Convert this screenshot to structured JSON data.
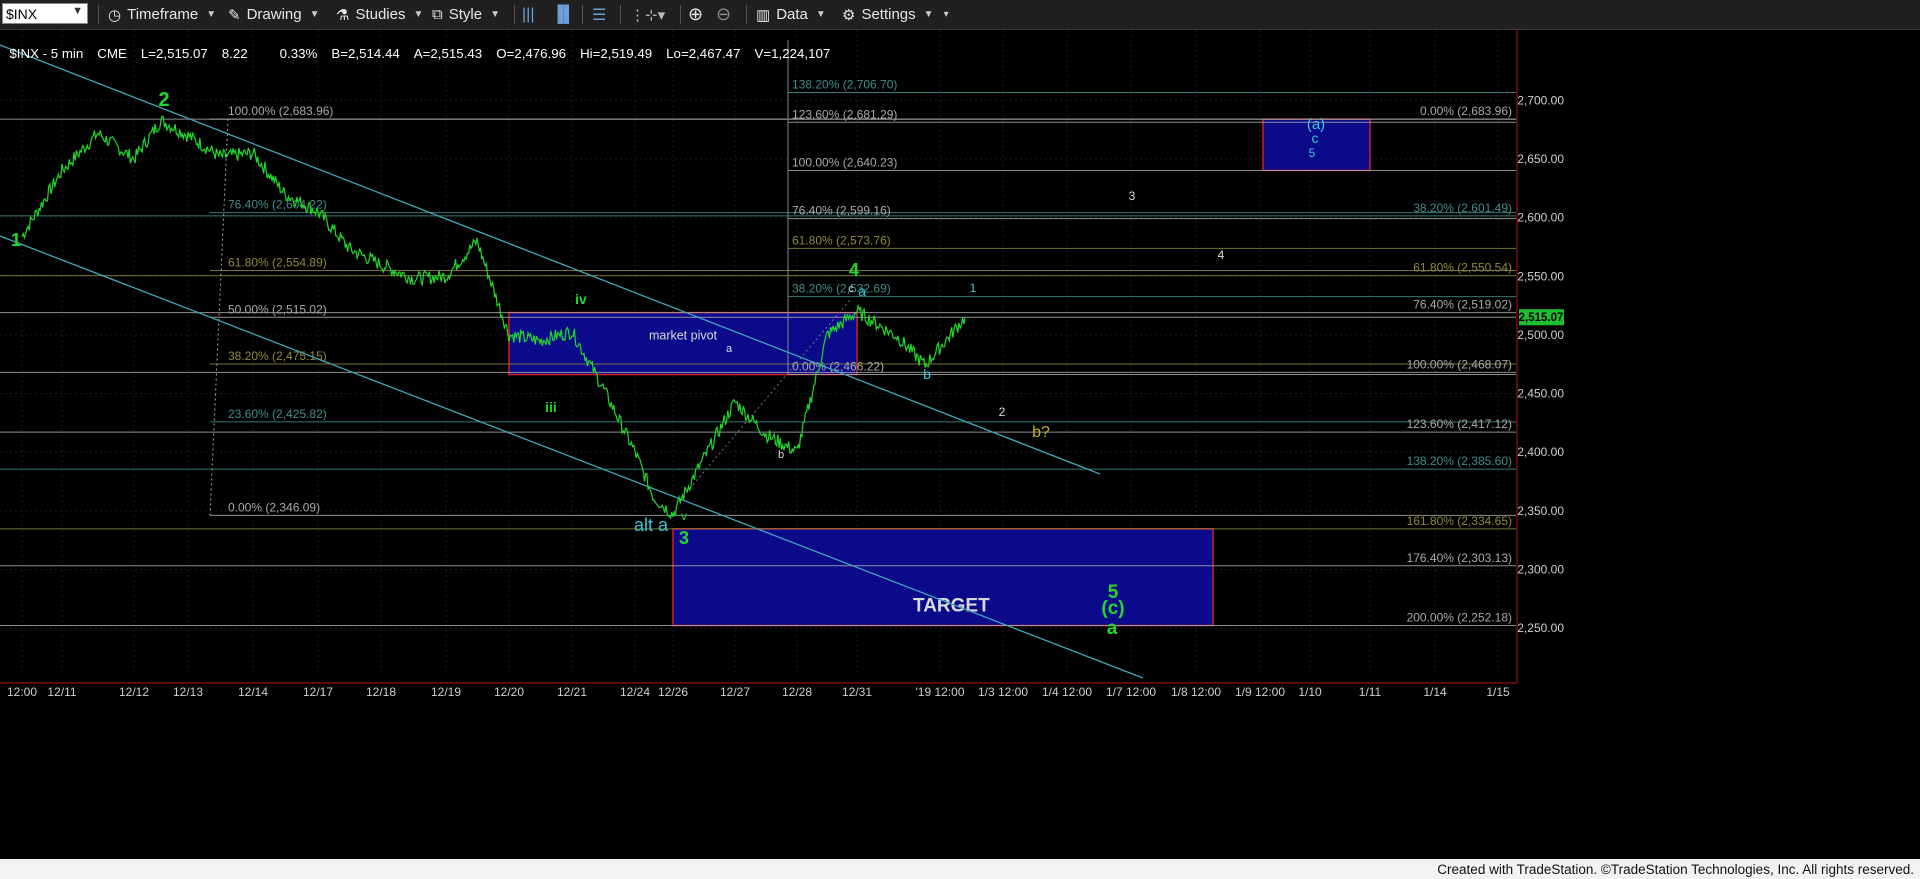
{
  "toolbar": {
    "symbol": "$INX",
    "items": [
      {
        "label": "Timeframe",
        "icon": "clock-icon"
      },
      {
        "label": "Drawing",
        "icon": "pencil-icon"
      },
      {
        "label": "Studies",
        "icon": "flask-icon"
      },
      {
        "label": "Style",
        "icon": "style-icon"
      },
      {
        "label": "Data",
        "icon": "bar-chart-icon"
      },
      {
        "label": "Settings",
        "icon": "gear-icon"
      }
    ]
  },
  "quote": {
    "symbol": "$INX - 5 min",
    "exchange": "CME",
    "last": "L=2,515.07",
    "change": "8.22",
    "pct": "0.33%",
    "bid": "B=2,514.44",
    "ask": "A=2,515.43",
    "open": "O=2,476.96",
    "high": "Hi=2,519.49",
    "low": "Lo=2,467.47",
    "volume": "V=1,224,107"
  },
  "footer": "Created with TradeStation. ©TradeStation Technologies, Inc. All rights reserved.",
  "colors": {
    "background": "#000000",
    "price_line": "#22d82a",
    "channel": "#3fa7b8",
    "box_fill": "#0a0a8a",
    "box_border": "#c8202a",
    "fib_left": "#a9a9a9",
    "fib_teal": "#3f8e8a",
    "fib_olive": "#8e8a3a",
    "wave_green": "#22d82a",
    "wave_cyan": "#39c6d6",
    "wave_yellow": "#c8b41e"
  },
  "chart_data": {
    "type": "line",
    "series": [
      {
        "name": "$INX - 5 min",
        "points": [
          [
            "12/10 12:00",
            2584
          ],
          [
            "12/11",
            2640
          ],
          [
            "12/11 12:00",
            2672
          ],
          [
            "12/12",
            2650
          ],
          [
            "12/12 12:00",
            2683
          ],
          [
            "12/13",
            2670
          ],
          [
            "12/13 12:00",
            2652
          ],
          [
            "12/14",
            2655
          ],
          [
            "12/14 12:00",
            2620
          ],
          [
            "12/17",
            2605
          ],
          [
            "12/17 12:00",
            2573
          ],
          [
            "12/18",
            2560
          ],
          [
            "12/18 12:00",
            2548
          ],
          [
            "12/19",
            2550
          ],
          [
            "12/19 12:00",
            2580
          ],
          [
            "12/20",
            2500
          ],
          [
            "12/20 12:00",
            2495
          ],
          [
            "12/21",
            2503
          ],
          [
            "12/21 12:00",
            2455
          ],
          [
            "12/24",
            2400
          ],
          [
            "12/24 12:00",
            2361
          ],
          [
            "12/26",
            2347
          ],
          [
            "12/26 12:00",
            2395
          ],
          [
            "12/27",
            2443
          ],
          [
            "12/27 12:00",
            2415
          ],
          [
            "12/28",
            2400
          ],
          [
            "12/28 12:00",
            2500
          ],
          [
            "12/31",
            2520
          ],
          [
            "12/31 12:00",
            2498
          ],
          [
            "1/2",
            2474
          ],
          [
            "1/2 12:00",
            2515
          ]
        ]
      }
    ],
    "x_tick_labels": [
      "12:00",
      "12/11",
      "12/12",
      "12/13",
      "12/14",
      "12/17",
      "12/18",
      "12/19",
      "12/20",
      "12/21",
      "12/24",
      "12/26",
      "12/27",
      "12/28",
      "12/31",
      "'19 12:00",
      "1/3 12:00",
      "1/4 12:00",
      "1/7 12:00",
      "1/8 12:00",
      "1/9 12:00",
      "1/10",
      "1/11",
      "1/14",
      "1/15"
    ],
    "y_ticks": [
      2250,
      2300,
      2350,
      2400,
      2450,
      2500,
      2550,
      2600,
      2650,
      2700
    ],
    "y_tick_labels": [
      "2,250.00",
      "2,300.00",
      "2,350.00",
      "2,400.00",
      "2,450.00",
      "2,500.00",
      "2,550.00",
      "2,600.00",
      "2,650.00",
      "2,700.00"
    ],
    "ylim": [
      2210,
      2760
    ],
    "last_price": 2515.07,
    "last_price_label": "2,515.07",
    "grid": true,
    "fib_left": [
      {
        "label": "100.00% (2,683.96)",
        "value": 2683.96,
        "color": "#a9a9a9"
      },
      {
        "label": "76.40% (2,604.22)",
        "value": 2604.22,
        "color": "#3f8e8a"
      },
      {
        "label": "61.80% (2,554.89)",
        "value": 2554.89,
        "color": "#8e8a3a"
      },
      {
        "label": "50.00% (2,515.02)",
        "value": 2515.02,
        "color": "#a9a9a9"
      },
      {
        "label": "38.20% (2,475.15)",
        "value": 2475.15,
        "color": "#8e8a3a"
      },
      {
        "label": "23.60% (2,425.82)",
        "value": 2425.82,
        "color": "#3f8e8a"
      },
      {
        "label": "0.00% (2,346.09)",
        "value": 2346.09,
        "color": "#a9a9a9"
      }
    ],
    "fib_mid": [
      {
        "label": "138.20% (2,706.70)",
        "value": 2706.7,
        "color": "#3f8e8a"
      },
      {
        "label": "123.60% (2,681.29)",
        "value": 2681.29,
        "color": "#a9a9a9"
      },
      {
        "label": "100.00% (2,640.23)",
        "value": 2640.23,
        "color": "#a9a9a9"
      },
      {
        "label": "76.40% (2,599.16)",
        "value": 2599.16,
        "color": "#a9a9a9"
      },
      {
        "label": "61.80% (2,573.76)",
        "value": 2573.76,
        "color": "#8e8a3a"
      },
      {
        "label": "38.20% (2,532.69)",
        "value": 2532.69,
        "color": "#3f8e8a"
      },
      {
        "label": "0.00% (2,466.22)",
        "value": 2466.22,
        "color": "#a9a9a9"
      }
    ],
    "fib_right": [
      {
        "label": "0.00% (2,683.96)",
        "value": 2683.96,
        "color": "#a9a9a9"
      },
      {
        "label": "38.20% (2,601.49)",
        "value": 2601.49,
        "color": "#3f8e8a"
      },
      {
        "label": "61.80% (2,550.54)",
        "value": 2550.54,
        "color": "#8e8a3a"
      },
      {
        "label": "76.40% (2,519.02)",
        "value": 2519.02,
        "color": "#a9a9a9"
      },
      {
        "label": "100.00% (2,468.07)",
        "value": 2468.07,
        "color": "#a9a9a9"
      },
      {
        "label": "123.60% (2,417.12)",
        "value": 2417.12,
        "color": "#a9a9a9"
      },
      {
        "label": "138.20% (2,385.60)",
        "value": 2385.6,
        "color": "#3f8e8a"
      },
      {
        "label": "161.80% (2,334.65)",
        "value": 2334.65,
        "color": "#8e8a3a"
      },
      {
        "label": "176.40% (2,303.13)",
        "value": 2303.13,
        "color": "#a9a9a9"
      },
      {
        "label": "200.00% (2,252.18)",
        "value": 2252.18,
        "color": "#a9a9a9"
      }
    ],
    "boxes": [
      {
        "name": "market-pivot",
        "label": "market pivot",
        "y_top": 2519.02,
        "y_bottom": 2466.22,
        "x_from": "12/20",
        "x_to": "12/31"
      },
      {
        "name": "target",
        "label": "TARGET",
        "y_top": 2334.65,
        "y_bottom": 2252.18,
        "x_from": "12/26",
        "x_to": "1/8 12:00"
      },
      {
        "name": "wave-a-target",
        "label": "",
        "y_top": 2683.96,
        "y_bottom": 2640.23,
        "x_from": "1/9",
        "x_to": "1/10 12:00"
      }
    ],
    "wave_labels": [
      "1",
      "2",
      "iii",
      "iv",
      "v",
      "3",
      "alt a",
      "a",
      "b",
      "c",
      "4",
      "a",
      "b",
      "1",
      "2",
      "3",
      "4",
      "b?",
      "(a)",
      "c",
      "5",
      "5",
      "(c)",
      "a"
    ]
  }
}
